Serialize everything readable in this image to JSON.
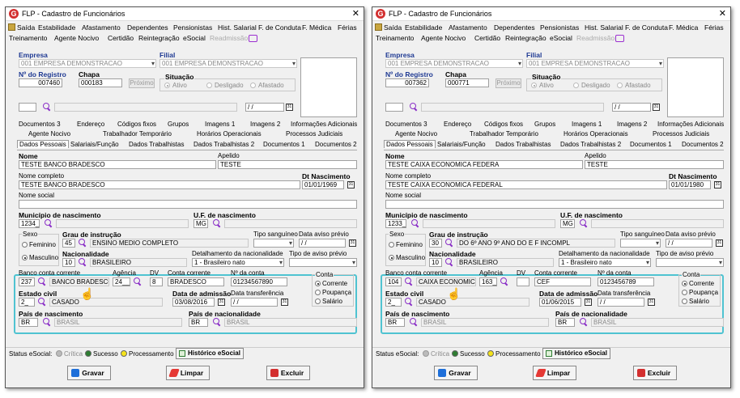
{
  "common": {
    "window_title": "FLP - Cadastro de Funcionários",
    "close_glyph": "✕",
    "menu": {
      "saida": "Saída",
      "estabilidade": "Estabilidade",
      "afastamento": "Afastamento",
      "dependentes": "Dependentes",
      "pensionistas": "Pensionistas",
      "hist_salarial": "Hist. Salarial",
      "f_conduta": "F. de Conduta",
      "f_medica": "F. Médica",
      "ferias": "Férias",
      "treinamento": "Treinamento",
      "agente_nocivo": "Agente Nocivo",
      "certidao": "Certidão",
      "reintegracao": "Reintegração",
      "esocial": "eSocial",
      "readmissao": "Readmissão"
    },
    "labels": {
      "empresa": "Empresa",
      "filial": "Filial",
      "n_registro": "Nº do Registro",
      "chapa": "Chapa",
      "proximo": "Próximo",
      "situacao": "Situação",
      "ativo": "Ativo",
      "desligado": "Desligado",
      "afastado": "Afastado",
      "date_blank": " / /",
      "nome": "Nome",
      "apelido": "Apelido",
      "nome_completo": "Nome completo",
      "dt_nascimento": "Dt Nascimento",
      "nome_social": "Nome social",
      "municipio_nasc": "Município de nascimento",
      "uf_nasc": "U.F. de nascimento",
      "sexo": "Sexo",
      "grau_instrucao": "Grau de instrução",
      "tipo_sanguineo": "Tipo sanguíneo",
      "data_aviso_previo": "Data aviso prévio",
      "feminino": "Feminino",
      "masculino": "Masculino",
      "nacionalidade": "Nacionalidade",
      "detalhamento_nac": "Detalhamento da nacionalidade",
      "tipo_aviso_previo": "Tipo de aviso prévio",
      "banco_conta": "Banco conta corrente",
      "agencia": "Agência",
      "dv": "DV",
      "conta_corrente": "Conta corrente",
      "n_conta": "Nº da conta",
      "conta": "Conta",
      "corrente": "Corrente",
      "poupanca": "Poupança",
      "salario": "Salário",
      "estado_civil": "Estado civil",
      "data_admissao": "Data de admissão",
      "data_transferencia": "Data transferência",
      "pais_nascimento": "País de nascimento",
      "pais_nacionalidade": "País de nacionalidade"
    },
    "tabs_row1": [
      "Documentos 3",
      "Endereço",
      "Códigos fixos",
      "Grupos",
      "Imagens 1",
      "Imagens 2",
      "Informações Adicionais"
    ],
    "tabs_row2": [
      "Agente Nocivo",
      "Trabalhador Temporário",
      "Horários Operacionais",
      "Processos Judiciais"
    ],
    "tabs_row3": [
      "Dados Pessoais",
      "Salariais/Função",
      "Dados Trabalhistas",
      "Dados Trabalhistas 2",
      "Documentos 1",
      "Documentos 2"
    ],
    "status": {
      "label": "Status eSocial:",
      "critica": "Crítica",
      "sucesso": "Sucesso",
      "processamento": "Processamento",
      "historico": "Histórico eSocial"
    },
    "buttons": {
      "gravar": "Gravar",
      "limpar": "Limpar",
      "excluir": "Excluir"
    },
    "colors": {
      "highlight": "#4fc3d1",
      "icon_purple": "#8a2fc7",
      "label_blue": "#1f3a93",
      "sucesso": "#2e7d32",
      "processamento": "#f5e31b"
    }
  },
  "left": {
    "empresa": "001 EMPRESA DEMONSTRACAO",
    "filial": "001 EMPRESA DEMONSTRACAO",
    "registro": "007460",
    "chapa": "000183",
    "nome": "TESTE BANCO BRADESCO",
    "apelido": "TESTE",
    "nome_completo": "TESTE BANCO BRADESCO",
    "dt_nascimento": "01/01/1969",
    "municipio_code": "1234__",
    "uf": "MG",
    "grau_code": "45",
    "grau_desc": "ENSINO MEDIO COMPLETO",
    "nac_code": "10",
    "nac_desc": "BRASILEIRO",
    "detalhamento": "1 - Brasileiro nato",
    "aviso_date": " / /",
    "banco_code": "237",
    "banco_desc": "BANCO BRADESCO S",
    "agencia": "24__",
    "dv": "8",
    "conta_corrente": "BRADESCO",
    "n_conta": "01234567890",
    "estado_code": "2_",
    "estado_desc": "CASADO",
    "data_admissao": "03/08/2016",
    "data_transferencia": " / /",
    "pais_nasc_code": "BR",
    "pais_nasc_desc": "BRASIL",
    "pais_nac_code": "BR",
    "pais_nac_desc": "BRASIL"
  },
  "right": {
    "empresa": "001 EMPRESA DEMONSTRACAO",
    "filial": "001 EMPRESA DEMONSTRACAO",
    "registro": "007362",
    "chapa": "000771",
    "nome": "TESTE CAIXA ECONOMICA FEDERA",
    "apelido": "TESTE",
    "nome_completo": "TESTE CAIXA ECONOMICA FEDERAL",
    "dt_nascimento": "01/01/1980",
    "municipio_code": "1233__",
    "uf": "MG",
    "grau_code": "30",
    "grau_desc": "DO 6º ANO 9º ANO DO E F INCOMPL",
    "nac_code": "10",
    "nac_desc": "BRASILEIRO",
    "detalhamento": "1 - Brasileiro nato",
    "aviso_date": " / /",
    "banco_code": "104",
    "banco_desc": "CAIXA ECONOMICA F",
    "agencia": "163__",
    "dv": "",
    "conta_corrente": "CEF",
    "n_conta": "0123456789",
    "estado_code": "2_",
    "estado_desc": "CASADO",
    "data_admissao": "01/06/2015",
    "data_transferencia": " / /",
    "pais_nasc_code": "BR",
    "pais_nasc_desc": "BRASIL",
    "pais_nac_code": "BR",
    "pais_nac_desc": "BRASIL"
  }
}
